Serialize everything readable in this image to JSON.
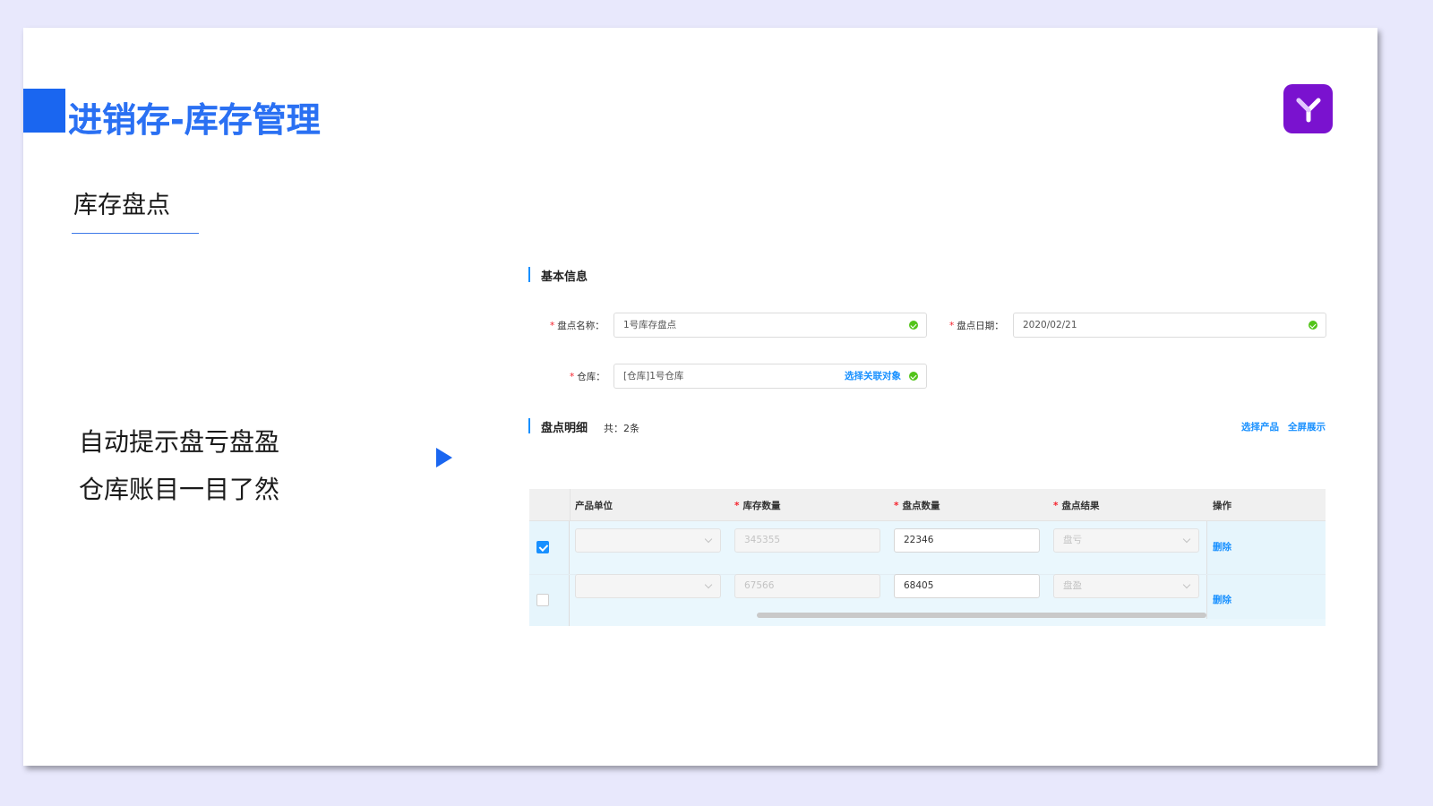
{
  "header": {
    "title": "进销存-库存管理",
    "section": "库存盘点",
    "desc_lines": [
      "自动提示盘亏盘盈",
      "仓库账目一目了然"
    ]
  },
  "logo": {
    "icon": "y-logo-icon",
    "color": "#7a12cf"
  },
  "basic_info": {
    "title": "基本信息",
    "name_label": "盘点名称：",
    "name_value": "1号库存盘点",
    "date_label": "盘点日期：",
    "date_value": "2020/02/21",
    "warehouse_label": "仓库：",
    "warehouse_value": "[仓库]1号仓库",
    "select_link": "选择关联对象"
  },
  "detail": {
    "title": "盘点明细",
    "count": "共：2条",
    "select_product": "选择产品",
    "fullscreen": "全屏展示",
    "columns": [
      "产品单位",
      "库存数量",
      "盘点数量",
      "盘点结果",
      "操作"
    ],
    "rows": [
      {
        "checked": true,
        "unit": "",
        "stock": "345355",
        "count": "22346",
        "result": "盘亏",
        "action": "删除"
      },
      {
        "checked": false,
        "unit": "",
        "stock": "67566",
        "count": "68405",
        "result": "盘盈",
        "action": "删除"
      }
    ]
  },
  "colors": {
    "accent": "#1a66f0",
    "link": "#1890ff",
    "required": "#f5222d",
    "ok": "#52c41a"
  }
}
